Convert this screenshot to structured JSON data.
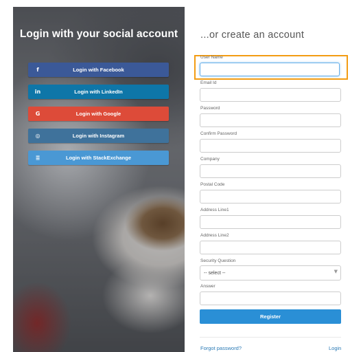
{
  "social": {
    "title": "Login with your social account",
    "buttons": [
      {
        "label": "Login with Facebook",
        "icon": "facebook-icon",
        "glyph": "f",
        "color": "#3b5998"
      },
      {
        "label": "Login with LinkedIn",
        "icon": "linkedin-icon",
        "glyph": "in",
        "color": "#0e76a8"
      },
      {
        "label": "Login with Google",
        "icon": "google-icon",
        "glyph": "G",
        "color": "#dd4b39"
      },
      {
        "label": "Login with Instagram",
        "icon": "instagram-icon",
        "glyph": "◎",
        "color": "#3f729b"
      },
      {
        "label": "Login with StackExchange",
        "icon": "stackexchange-icon",
        "glyph": "≣",
        "color": "#4a98d4"
      }
    ]
  },
  "form": {
    "title": "...or create an account",
    "fields": {
      "username": {
        "label": "User Name",
        "value": ""
      },
      "email": {
        "label": "Email Id",
        "value": ""
      },
      "password": {
        "label": "Password",
        "value": ""
      },
      "confirm_password": {
        "label": "Confirm Password",
        "value": ""
      },
      "company": {
        "label": "Company",
        "value": ""
      },
      "postal_code": {
        "label": "Postal Code",
        "value": ""
      },
      "address1": {
        "label": "Address Line1",
        "value": ""
      },
      "address2": {
        "label": "Address Line2",
        "value": ""
      },
      "security_question": {
        "label": "Security Question",
        "selected": "-- select --"
      },
      "answer": {
        "label": "Answer",
        "value": ""
      }
    },
    "register_label": "Register",
    "forgot_password": "Forgot password?",
    "login_link": "Login",
    "accent_color": "#2a8fd6",
    "highlight_color": "#f39c12"
  }
}
